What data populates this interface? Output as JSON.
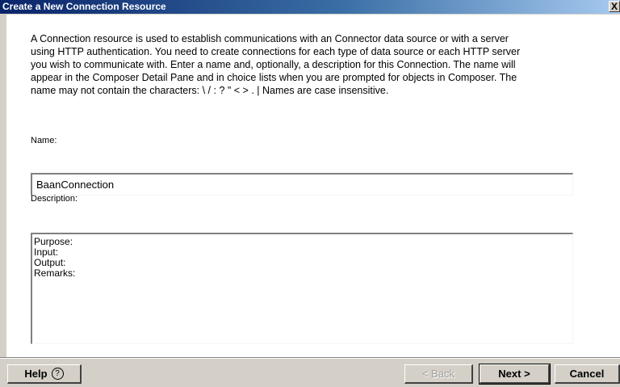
{
  "window": {
    "title": "Create a New Connection Resource",
    "close_glyph": "X"
  },
  "intro": {
    "lines": [
      "A Connection resource is used to establish communications with an Connector data source or with a server",
      "using HTTP authentication. You need to create connections for each type of data source or each HTTP server",
      "you wish to communicate with.  Enter a name and, optionally, a description for this Connection.  The name will",
      "appear in the Composer Detail Pane and in choice lists when you are prompted for objects in Composer.  The",
      "name may not contain the characters: \\ / : ? \" < > . |  Names are case insensitive."
    ]
  },
  "form": {
    "name_label": "Name:",
    "name_value": "BaanConnection",
    "description_label": "Description:",
    "description_lines": [
      "Purpose:",
      "Input:",
      "Output:",
      "Remarks:"
    ]
  },
  "buttons": {
    "help": "Help",
    "help_icon": "?",
    "back": "< Back",
    "next": "Next >",
    "cancel": "Cancel"
  }
}
